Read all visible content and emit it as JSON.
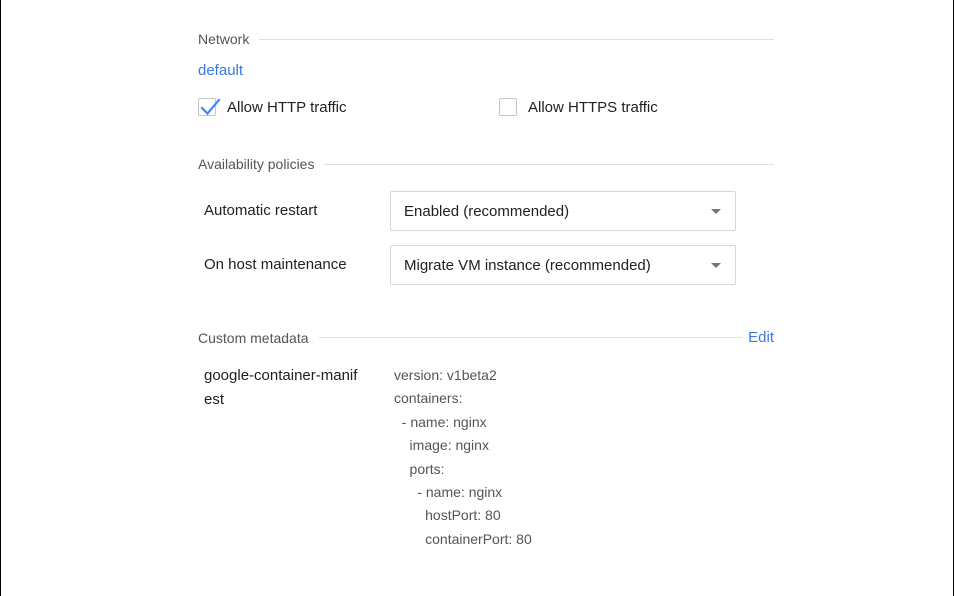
{
  "network": {
    "title": "Network",
    "value_link": "default",
    "allow_http": {
      "label": "Allow HTTP traffic",
      "checked": true
    },
    "allow_https": {
      "label": "Allow HTTPS traffic",
      "checked": false
    }
  },
  "availability": {
    "title": "Availability policies",
    "automatic_restart": {
      "label": "Automatic restart",
      "value": "Enabled (recommended)"
    },
    "host_maintenance": {
      "label": "On host maintenance",
      "value": "Migrate VM instance (recommended)"
    }
  },
  "metadata": {
    "title": "Custom metadata",
    "edit_label": "Edit",
    "key_line1": "google-container-manif",
    "key_line2": "est",
    "value": "version: v1beta2\ncontainers:\n  - name: nginx\n    image: nginx\n    ports:\n      - name: nginx\n        hostPort: 80\n        containerPort: 80"
  },
  "colors": {
    "accent": "#3b78e7",
    "check": "#4285f4"
  },
  "icons": {
    "checkmark": "checkmark-icon",
    "dropdown": "chevron-down-icon"
  }
}
